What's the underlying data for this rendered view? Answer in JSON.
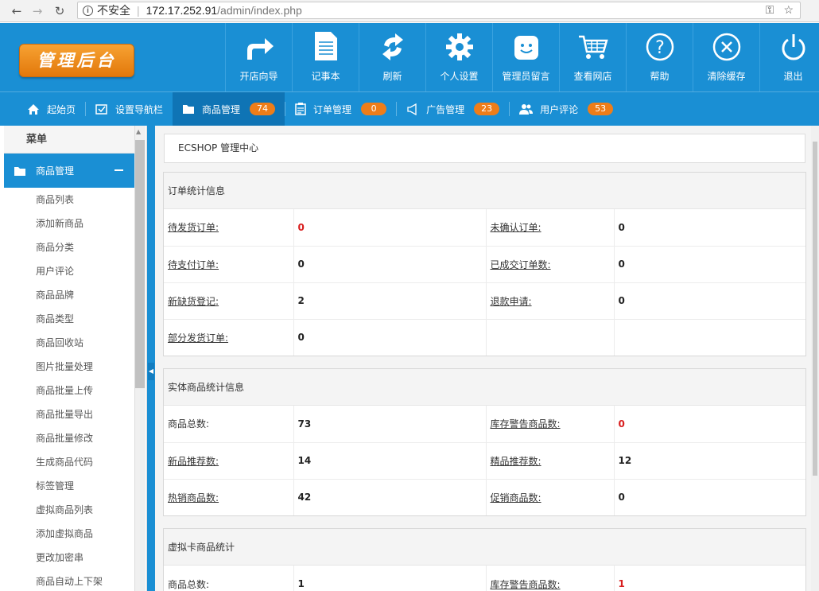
{
  "browser": {
    "security_label": "不安全",
    "url_host": "172.17.252.91",
    "url_path": "/admin/index.php"
  },
  "header": {
    "logo_text": "管理后台",
    "nav": [
      {
        "label": "开店向导",
        "icon": "share-arrow-icon"
      },
      {
        "label": "记事本",
        "icon": "notepad-icon"
      },
      {
        "label": "刷新",
        "icon": "refresh-icon"
      },
      {
        "label": "个人设置",
        "icon": "gear-icon"
      },
      {
        "label": "管理员留言",
        "icon": "chat-smile-icon"
      },
      {
        "label": "查看网店",
        "icon": "cart-icon"
      },
      {
        "label": "帮助",
        "icon": "help-icon"
      },
      {
        "label": "清除缓存",
        "icon": "clear-icon"
      },
      {
        "label": "退出",
        "icon": "power-icon"
      }
    ]
  },
  "subnav": {
    "items": [
      {
        "label": "起始页",
        "icon": "home-icon"
      },
      {
        "label": "设置导航栏",
        "icon": "checkbox-icon"
      },
      {
        "label": "商品管理",
        "icon": "folder-icon",
        "badge": "74",
        "active": true
      },
      {
        "label": "订单管理",
        "icon": "clipboard-icon",
        "badge": "0"
      },
      {
        "label": "广告管理",
        "icon": "megaphone-icon",
        "badge": "23"
      },
      {
        "label": "用户评论",
        "icon": "users-icon",
        "badge": "53"
      }
    ]
  },
  "sidebar": {
    "menu_title": "菜单",
    "group_label": "商品管理",
    "items": [
      "商品列表",
      "添加新商品",
      "商品分类",
      "用户评论",
      "商品品牌",
      "商品类型",
      "商品回收站",
      "图片批量处理",
      "商品批量上传",
      "商品批量导出",
      "商品批量修改",
      "生成商品代码",
      "标签管理",
      "虚拟商品列表",
      "添加虚拟商品",
      "更改加密串",
      "商品自动上下架"
    ]
  },
  "main": {
    "title": "ECSHOP 管理中心",
    "order_stats": {
      "heading": "订单统计信息",
      "rows": [
        [
          {
            "label": "待发货订单:",
            "link": true
          },
          {
            "value": "0",
            "red": true
          },
          {
            "label": "未确认订单:",
            "link": true
          },
          {
            "value": "0"
          }
        ],
        [
          {
            "label": "待支付订单:",
            "link": true
          },
          {
            "value": "0"
          },
          {
            "label": "已成交订单数:",
            "link": true
          },
          {
            "value": "0"
          }
        ],
        [
          {
            "label": "新缺货登记:",
            "link": true
          },
          {
            "value": "2"
          },
          {
            "label": "退款申请:",
            "link": true
          },
          {
            "value": "0"
          }
        ],
        [
          {
            "label": "部分发货订单:",
            "link": true
          },
          {
            "value": "0"
          },
          {
            "label": "",
            "link": false
          },
          {
            "value": ""
          }
        ]
      ]
    },
    "goods_stats": {
      "heading": "实体商品统计信息",
      "rows": [
        [
          {
            "label": "商品总数:",
            "link": false
          },
          {
            "value": "73"
          },
          {
            "label": "库存警告商品数:",
            "link": true
          },
          {
            "value": "0",
            "red": true
          }
        ],
        [
          {
            "label": "新品推荐数:",
            "link": true
          },
          {
            "value": "14"
          },
          {
            "label": "精品推荐数:",
            "link": true
          },
          {
            "value": "12"
          }
        ],
        [
          {
            "label": "热销商品数:",
            "link": true
          },
          {
            "value": "42"
          },
          {
            "label": "促销商品数:",
            "link": true
          },
          {
            "value": "0"
          }
        ]
      ]
    },
    "virtual_stats": {
      "heading": "虚拟卡商品统计",
      "rows": [
        [
          {
            "label": "商品总数:",
            "link": false
          },
          {
            "value": "1"
          },
          {
            "label": "库存警告商品数:",
            "link": true
          },
          {
            "value": "1",
            "red": true
          }
        ]
      ]
    }
  }
}
